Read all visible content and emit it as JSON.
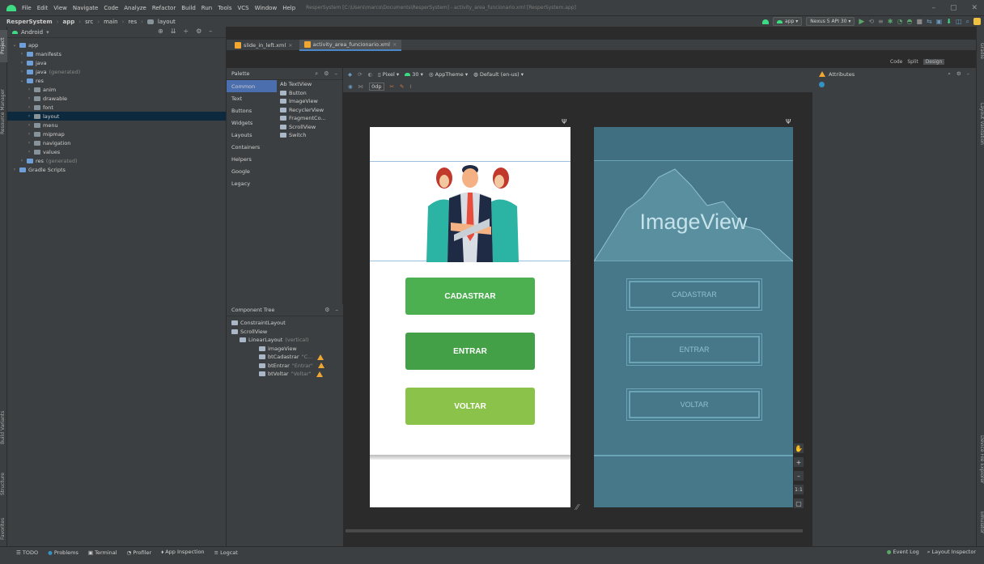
{
  "menubar": {
    "items": [
      "File",
      "Edit",
      "View",
      "Navigate",
      "Code",
      "Analyze",
      "Refactor",
      "Build",
      "Run",
      "Tools",
      "VCS",
      "Window",
      "Help"
    ],
    "window_title": "ResperSystem [C:\\Users\\marco\\Documents\\ResperSystem] - activity_area_funcionario.xml [ResperSystem.app]"
  },
  "breadcrumb": [
    "ResperSystem",
    "app",
    "src",
    "main",
    "res",
    "layout"
  ],
  "toolbar": {
    "run_config": "app",
    "device": "Nexus 5 API 30"
  },
  "project": {
    "view_label": "Android",
    "tree": [
      {
        "label": "app",
        "level": 0,
        "arrow": "v"
      },
      {
        "label": "manifests",
        "level": 1,
        "arrow": ">"
      },
      {
        "label": "java",
        "level": 1,
        "arrow": ">"
      },
      {
        "label": "java",
        "suffix": "(generated)",
        "level": 1,
        "arrow": ">"
      },
      {
        "label": "res",
        "level": 1,
        "arrow": "v"
      },
      {
        "label": "anim",
        "level": 2,
        "arrow": ">"
      },
      {
        "label": "drawable",
        "level": 2,
        "arrow": ">"
      },
      {
        "label": "font",
        "level": 2,
        "arrow": ">"
      },
      {
        "label": "layout",
        "level": 2,
        "arrow": ">",
        "selected": true
      },
      {
        "label": "menu",
        "level": 2,
        "arrow": ">"
      },
      {
        "label": "mipmap",
        "level": 2,
        "arrow": ">"
      },
      {
        "label": "navigation",
        "level": 2,
        "arrow": ">"
      },
      {
        "label": "values",
        "level": 2,
        "arrow": ">"
      },
      {
        "label": "res",
        "suffix": "(generated)",
        "level": 1,
        "arrow": ">"
      },
      {
        "label": "Gradle Scripts",
        "level": 0,
        "arrow": ">"
      }
    ]
  },
  "tabs": [
    {
      "label": "slide_in_left.xml",
      "active": false
    },
    {
      "label": "activity_area_funcionario.xml",
      "active": true
    }
  ],
  "view_modes": {
    "code": "Code",
    "split": "Split",
    "design": "Design"
  },
  "palette": {
    "title": "Palette",
    "categories": [
      "Common",
      "Text",
      "Buttons",
      "Widgets",
      "Layouts",
      "Containers",
      "Helpers",
      "Google",
      "Legacy"
    ],
    "items": [
      "Ab TextView",
      "Button",
      "ImageView",
      "RecyclerView",
      "FragmentCo...",
      "ScrollView",
      "Switch"
    ]
  },
  "design_toolbar": {
    "device": "Pixel",
    "api": "30",
    "theme": "AppTheme",
    "locale": "Default (en-us)",
    "margin": "0dp"
  },
  "component_tree": {
    "title": "Component Tree",
    "items": [
      {
        "label": "ConstraintLayout",
        "hint": "",
        "level": 0,
        "warn": false
      },
      {
        "label": "ScrollView",
        "hint": "",
        "level": 0,
        "warn": false
      },
      {
        "label": "LinearLayout",
        "hint": "(vertical)",
        "level": 1,
        "warn": false
      },
      {
        "label": "imageView",
        "hint": "",
        "level": 2,
        "warn": false
      },
      {
        "label": "btCadastrar",
        "hint": "\"C...",
        "level": 2,
        "warn": true
      },
      {
        "label": "btEntrar",
        "hint": "\"Entrar\"",
        "level": 2,
        "warn": true
      },
      {
        "label": "btVoltar",
        "hint": "\"Voltar\"",
        "level": 2,
        "warn": true
      }
    ]
  },
  "preview": {
    "buttons": [
      {
        "label": "CADASTRAR",
        "color": "#4caf50"
      },
      {
        "label": "ENTRAR",
        "color": "#43a047"
      },
      {
        "label": "VOLTAR",
        "color": "#8bc34a"
      }
    ]
  },
  "blueprint": {
    "image_label": "ImageView",
    "buttons": [
      "CADASTRAR",
      "ENTRAR",
      "VOLTAR"
    ]
  },
  "attributes": {
    "title": "Attributes"
  },
  "zoom": {
    "ratio": "1:1"
  },
  "side_tabs": {
    "left": [
      "Project",
      "Resource Manager",
      "Build Variants",
      "Structure",
      "Favorites"
    ],
    "right": [
      "Gradle",
      "Layout Validation",
      "Device File Explorer",
      "Emulator"
    ]
  },
  "statusbar": {
    "items": [
      "TODO",
      "Problems",
      "Terminal",
      "Profiler",
      "App Inspection",
      "Logcat"
    ],
    "right": [
      "Event Log",
      "Layout Inspector"
    ]
  }
}
